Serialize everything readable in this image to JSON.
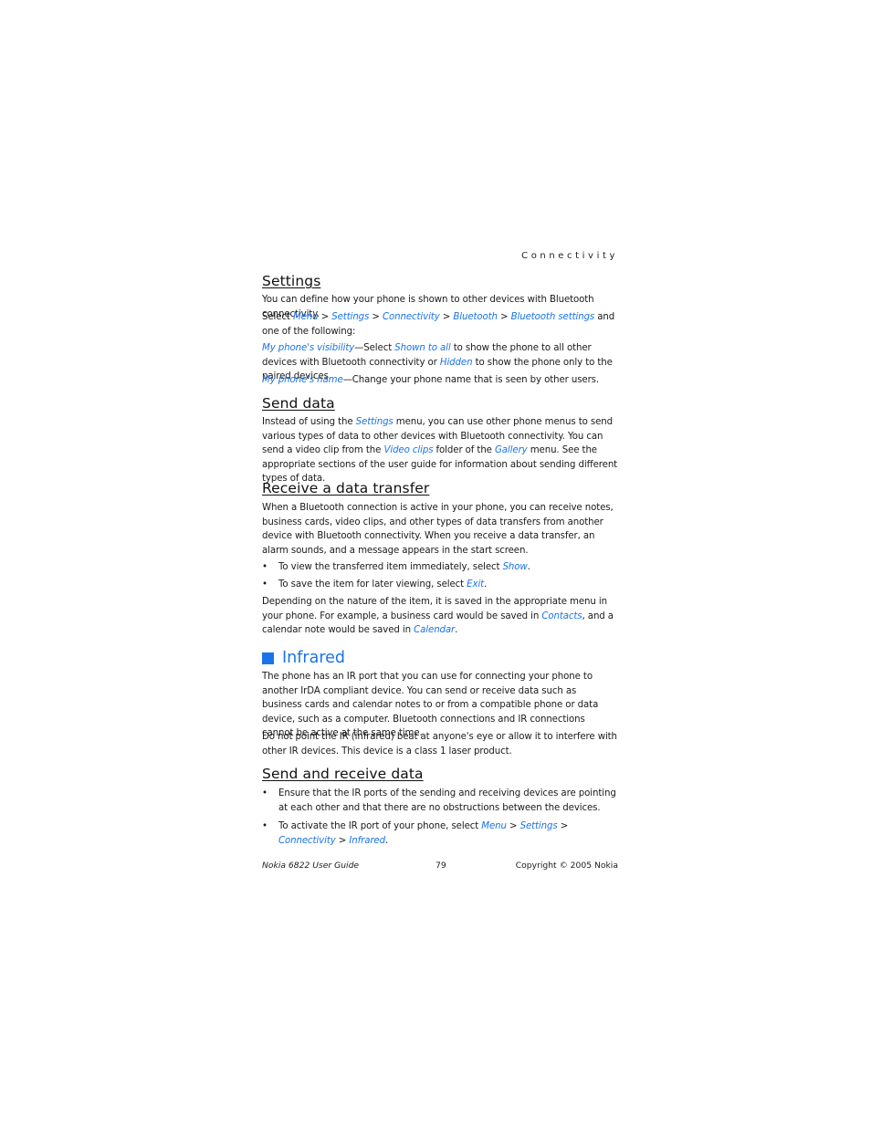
{
  "running_head": "Connectivity",
  "sections": {
    "settings": {
      "title": "Settings",
      "intro": "You can define how your phone is shown to other devices with Bluetooth connectivity.",
      "select_prefix": "Select ",
      "path": [
        "Menu",
        "Settings",
        "Connectivity",
        "Bluetooth",
        "Bluetooth settings"
      ],
      "sep": " > ",
      "select_suffix": " and one of the following:",
      "visibility": {
        "term": "My phone's visibility",
        "dash": "—Select ",
        "opt1": "Shown to all",
        "mid": " to show the phone to all other devices with Bluetooth connectivity or ",
        "opt2": "Hidden",
        "end": " to show the phone only to the paired devices."
      },
      "name": {
        "term": "My phone's name",
        "text": "—Change your phone name that is seen by other users."
      }
    },
    "send_data": {
      "title": "Send data",
      "t1": "Instead of using the ",
      "l1": "Settings",
      "t2": " menu, you can use other phone menus to send various types of data to other devices with Bluetooth connectivity. You can send a video clip from the ",
      "l2": "Video clips",
      "t3": " folder of the ",
      "l3": "Gallery",
      "t4": " menu. See the appropriate sections of the user guide for information about sending different types of data."
    },
    "receive": {
      "title": "Receive a data transfer",
      "intro": "When a Bluetooth connection is active in your phone, you can receive notes, business cards, video clips, and other types of data transfers from another device with Bluetooth connectivity. When you receive a data transfer, an alarm sounds, and a message appears in the start screen.",
      "bullets": [
        {
          "text": "To view the transferred item immediately, select ",
          "link": "Show",
          "end": "."
        },
        {
          "text": "To save the item for later viewing, select ",
          "link": "Exit",
          "end": "."
        }
      ],
      "outro_1": "Depending on the nature of the item, it is saved in the appropriate menu in your phone. For example, a business card would be saved in ",
      "outro_l1": "Contacts",
      "outro_2": ", and a calendar note would be saved in ",
      "outro_l2": "Calendar",
      "outro_3": "."
    },
    "infrared": {
      "title": "Infrared",
      "p1": "The phone has an IR port that you can use for connecting your phone to another IrDA compliant device. You can send or receive data such as business cards and calendar notes to or from a compatible phone or data device, such as a computer. Bluetooth connections and IR connections cannot be active at the same time.",
      "p2": "Do not point the IR (infrared) beat at anyone's eye or allow it to interfere with other IR devices. This device is a class 1 laser product."
    },
    "send_receive": {
      "title": "Send and receive data",
      "b1": "Ensure that the IR ports of the sending and receiving devices are pointing at each other and that there are no obstructions between the devices.",
      "b2_text": "To activate the IR port of your phone, select ",
      "b2_path": [
        "Menu",
        "Settings",
        "Connectivity",
        "Infrared"
      ],
      "b2_end": "."
    }
  },
  "footer": {
    "left": "Nokia 6822 User Guide",
    "page": "79",
    "right": "Copyright © 2005 Nokia"
  },
  "colors": {
    "link": "#1a73e8",
    "text": "#1a1a1a"
  }
}
